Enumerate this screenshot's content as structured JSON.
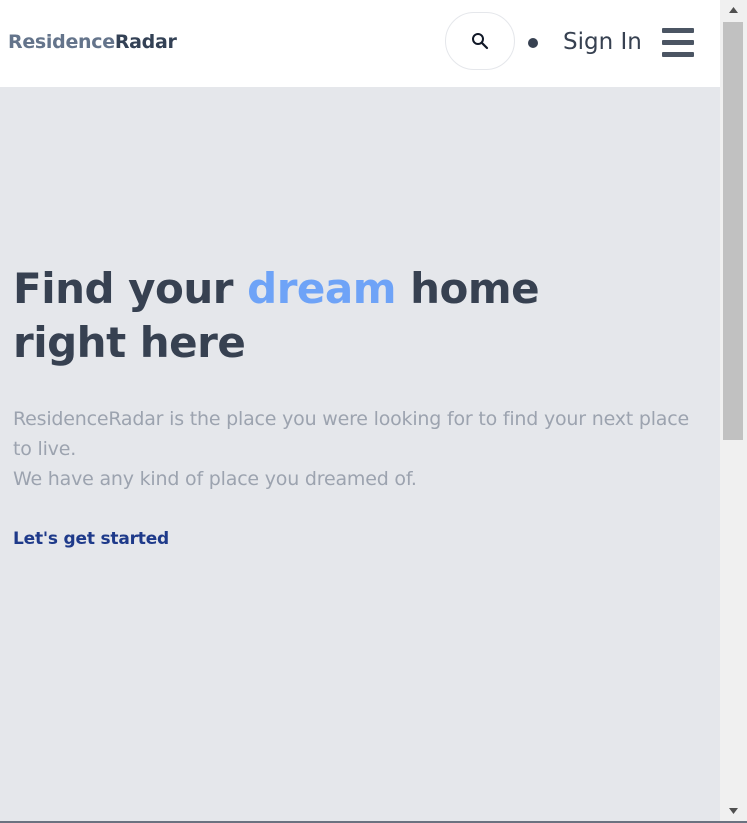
{
  "navbar": {
    "brand_part1": "Residence",
    "brand_part2": "Radar",
    "search_icon": "search-icon",
    "signin_label": "Sign In",
    "menu_icon": "hamburger-menu-icon"
  },
  "hero": {
    "title_part1": "Find your ",
    "title_accent": "dream",
    "title_part2": " home",
    "title_line2": "right here",
    "description_line1": "ResidenceRadar is the place you were looking for to find your next place to live.",
    "description_line2": "We have any kind of place you dreamed of.",
    "cta_label": "Let's get started"
  },
  "colors": {
    "background": "#e5e7eb",
    "navbar": "#ffffff",
    "title": "#374151",
    "accent": "#6ea3f7",
    "description": "#9ca3af",
    "cta": "#1e3a8a"
  },
  "scrollbar": {
    "up_icon": "arrow-up-icon",
    "down_icon": "arrow-down-icon"
  }
}
